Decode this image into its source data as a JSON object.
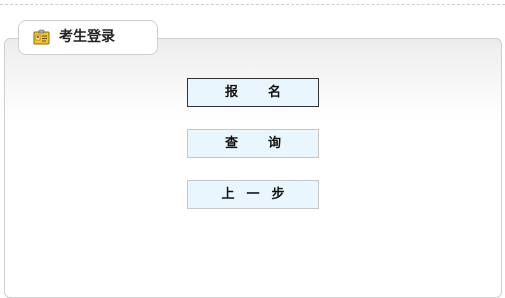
{
  "tab": {
    "title": "考生登录",
    "icon": "id-card-icon"
  },
  "buttons": {
    "register": "报名",
    "query": "查询",
    "back": "上一步"
  }
}
